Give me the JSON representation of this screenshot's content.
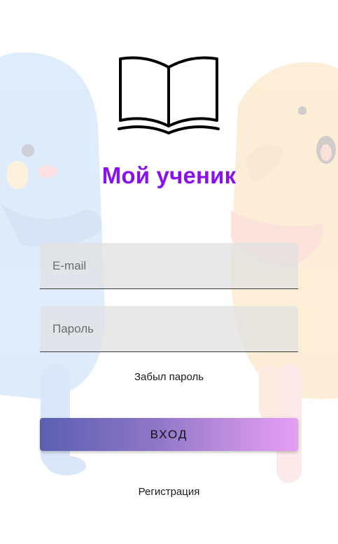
{
  "app": {
    "title": "Мой ученик",
    "title_color": "#8a10f0",
    "logo_icon": "open-book-icon"
  },
  "form": {
    "email_placeholder": "E-mail",
    "email_value": "",
    "password_placeholder": "Пароль",
    "password_value": "",
    "forgot_label": "Забыл пароль",
    "login_label": "ВХОД",
    "register_label": "Регистрация"
  },
  "colors": {
    "button_gradient_start": "#5b5fb0",
    "button_gradient_end": "#e59ef5",
    "field_background": "#e1e1e1"
  }
}
